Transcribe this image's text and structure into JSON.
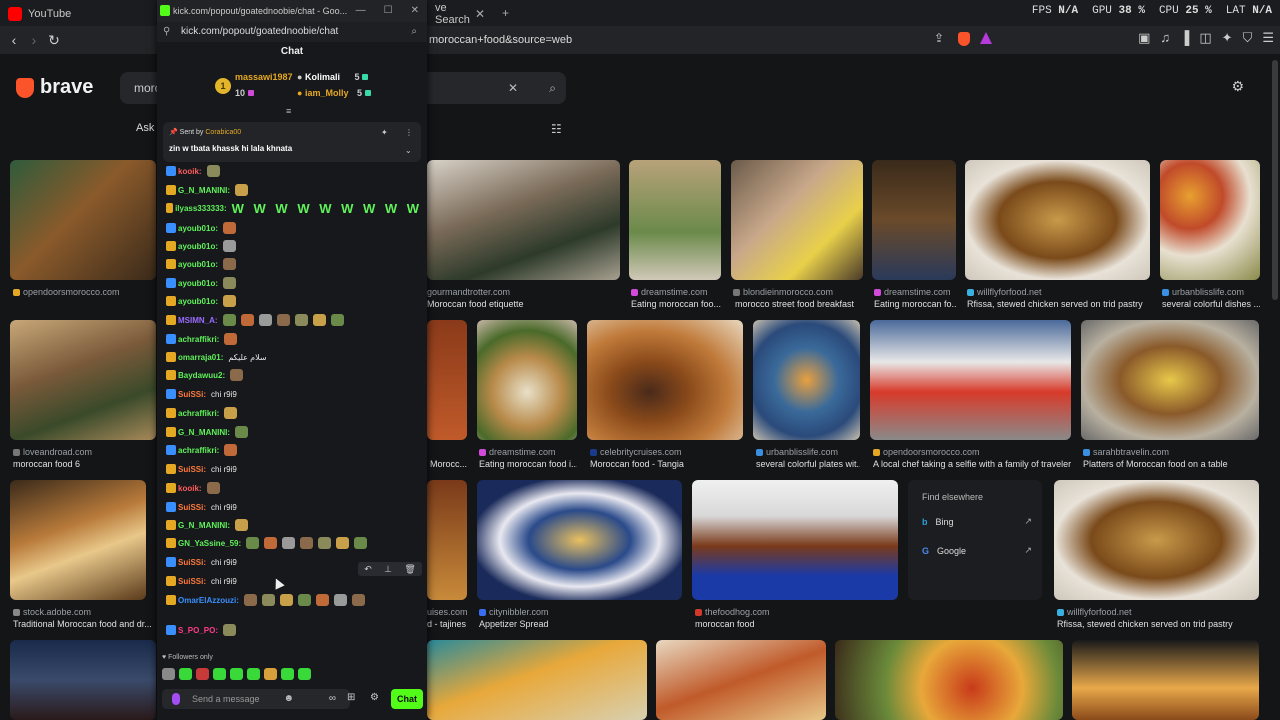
{
  "tabs": [
    {
      "label": "YouTube",
      "color": "#ff0000"
    },
    {
      "label": "ve Search",
      "color": "#fb542b"
    }
  ],
  "perf": [
    {
      "label": "FPS",
      "value": "N/A"
    },
    {
      "label": "GPU",
      "value": "38 %"
    },
    {
      "label": "CPU",
      "value": "25 %"
    },
    {
      "label": "LAT",
      "value": "N/A"
    }
  ],
  "address_visible": "moroccan+food&source=web",
  "brave": {
    "logo": "brave",
    "query": "moro",
    "ask": "Ask"
  },
  "images": [
    {
      "source": "opendoorsmorocco.com",
      "title": "",
      "src_color": "#e5a823"
    },
    {
      "source": "gourmandtrotter.com",
      "title": "Moroccan food etiquette",
      "src_color": "#888"
    },
    {
      "source": "dreamstime.com",
      "title": "Eating moroccan foo...",
      "src_color": "#d14ad9"
    },
    {
      "source": "blondieinmorocco.com",
      "title": "morocco street food breakfast",
      "src_color": "#777"
    },
    {
      "source": "dreamstime.com",
      "title": "Eating moroccan fo...",
      "src_color": "#d14ad9"
    },
    {
      "source": "willflyforfood.net",
      "title": "Rfissa, stewed chicken served on trid pastry",
      "src_color": "#3ab0e0"
    },
    {
      "source": "urbanblisslife.com",
      "title": "several colorful dishes ...",
      "src_color": "#3a8fe0"
    },
    {
      "source": "loveandroad.com",
      "title": "moroccan food 6",
      "src_color": "#777"
    },
    {
      "source": "",
      "title": "Morocc...",
      "src_color": "#777"
    },
    {
      "source": "dreamstime.com",
      "title": "Eating moroccan food i...",
      "src_color": "#d14ad9"
    },
    {
      "source": "celebritycruises.com",
      "title": "Moroccan food - Tangia",
      "src_color": "#1a3a8a"
    },
    {
      "source": "urbanblisslife.com",
      "title": "several colorful plates wit...",
      "src_color": "#3a8fe0"
    },
    {
      "source": "opendoorsmorocco.com",
      "title": "A local chef taking a selfie with a family of traveler...",
      "src_color": "#e5a823"
    },
    {
      "source": "sarahbtravelin.com",
      "title": "Platters of Moroccan food on a table",
      "src_color": "#3a8fe0"
    },
    {
      "source": "stock.adobe.com",
      "title": "Traditional Moroccan food and dr...",
      "src_color": "#888"
    },
    {
      "source": "uises.com",
      "title": "d - tajines",
      "src_color": "#777"
    },
    {
      "source": "citynibbler.com",
      "title": "Appetizer Spread",
      "src_color": "#3a6ef0"
    },
    {
      "source": "thefoodhog.com",
      "title": "moroccan food",
      "src_color": "#d13a2a"
    },
    {
      "source": "willflyforfood.net",
      "title": "Rfissa, stewed chicken served on trid pastry",
      "src_color": "#3ab0e0"
    }
  ],
  "find_elsewhere": {
    "heading": "Find elsewhere",
    "items": [
      "Bing",
      "Google"
    ]
  },
  "popout": {
    "window_title": "kick.com/popout/goatednoobie/chat - Goo...",
    "url": "kick.com/popout/goatednoobie/chat",
    "chat_heading": "Chat",
    "leaderboard": [
      {
        "name": "massawi1987",
        "count": "10",
        "color": "#e5a823"
      },
      {
        "name": "Kolimali",
        "count": "5",
        "color": "#ffffff"
      },
      {
        "name": "iam_Molly",
        "count": "5",
        "color": "#e5a823"
      }
    ],
    "rank": "1",
    "pinned": {
      "sent_by_label": "Sent by",
      "sent_by": "Corabica00",
      "message": "zin w tbata khassk hi lala khnata"
    },
    "messages": [
      {
        "user": "kooik:",
        "color": "#ff5c5c",
        "text": ""
      },
      {
        "user": "G_N_MANINI:",
        "color": "#5ff25a",
        "text": ""
      },
      {
        "user": "ilyass333333:",
        "color": "#5ff25a",
        "text": "W W W W W W W W W"
      },
      {
        "user": "ayoub01o:",
        "color": "#5ff25a",
        "text": ""
      },
      {
        "user": "ayoub01o:",
        "color": "#5ff25a",
        "text": ""
      },
      {
        "user": "ayoub01o:",
        "color": "#5ff25a",
        "text": ""
      },
      {
        "user": "ayoub01o:",
        "color": "#5ff25a",
        "text": ""
      },
      {
        "user": "ayoub01o:",
        "color": "#5ff25a",
        "text": ""
      },
      {
        "user": "MSIMN_A:",
        "color": "#9a6cff",
        "text": ""
      },
      {
        "user": "achraffikri:",
        "color": "#5ff25a",
        "text": ""
      },
      {
        "user": "omarraja01:",
        "color": "#5ff25a",
        "text": "سلام عليكم"
      },
      {
        "user": "Baydawuu2:",
        "color": "#5ff25a",
        "text": ""
      },
      {
        "user": "SuiSSi:",
        "color": "#ff7a3c",
        "text": "chi r9i9"
      },
      {
        "user": "achraffikri:",
        "color": "#5ff25a",
        "text": ""
      },
      {
        "user": "G_N_MANINI:",
        "color": "#5ff25a",
        "text": ""
      },
      {
        "user": "achraffikri:",
        "color": "#5ff25a",
        "text": ""
      },
      {
        "user": "SuiSSi:",
        "color": "#ff7a3c",
        "text": "chi r9i9"
      },
      {
        "user": "kooik:",
        "color": "#ff5c5c",
        "text": ""
      },
      {
        "user": "SuiSSi:",
        "color": "#ff7a3c",
        "text": "chi r9i9"
      },
      {
        "user": "G_N_MANINI:",
        "color": "#5ff25a",
        "text": ""
      },
      {
        "user": "GN_YaSsine_59:",
        "color": "#5ff25a",
        "text": ""
      },
      {
        "user": "SuiSSi:",
        "color": "#ff7a3c",
        "text": "chi r9i9"
      },
      {
        "user": "SuiSSi:",
        "color": "#ff7a3c",
        "text": "chi r9i9"
      },
      {
        "user": "OmarElAzzouzi:",
        "color": "#3a8fff",
        "text": ""
      },
      {
        "user": "S_PO_PO:",
        "color": "#ff3c8a",
        "text": ""
      }
    ],
    "followers_only": "Followers only",
    "input_placeholder": "Send a message",
    "chat_button": "Chat"
  },
  "colors": {
    "kick_green": "#53fc18",
    "brave_orange": "#fb542b"
  }
}
